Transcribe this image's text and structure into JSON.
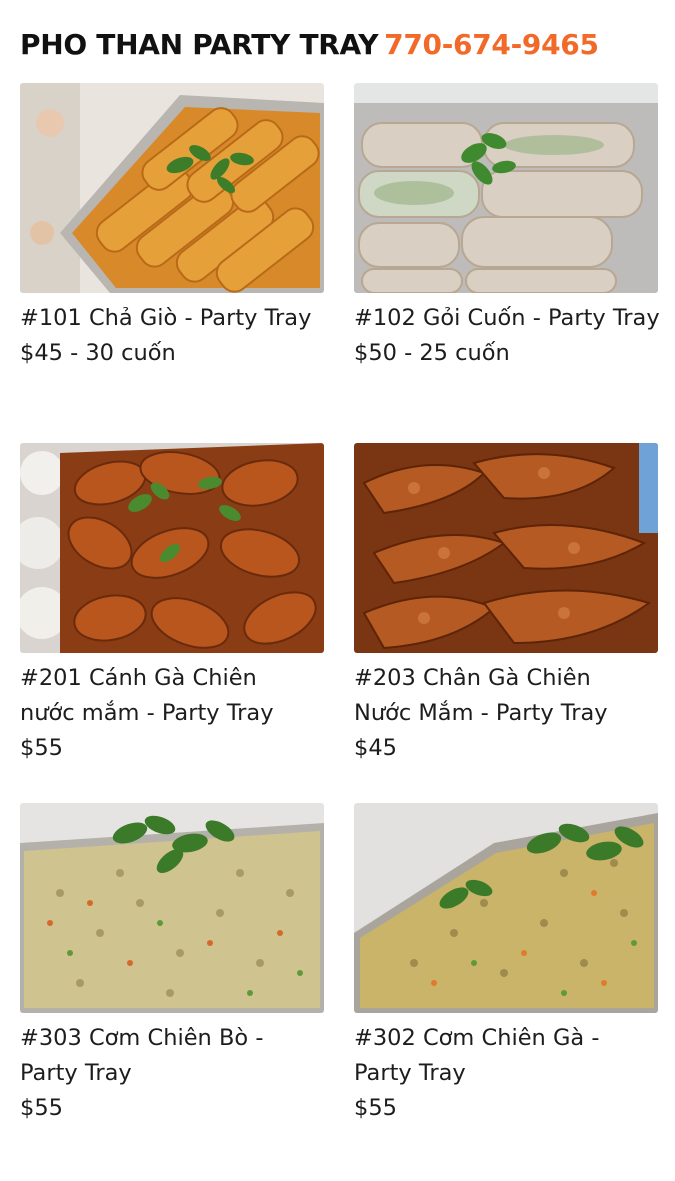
{
  "header": {
    "title": "PHO THAN PARTY TRAY",
    "phone": "770-674-9465"
  },
  "colors": {
    "accent": "#f26a2a"
  },
  "items": [
    {
      "name_lines": [
        "#101 Chả Giò - Party Tray"
      ],
      "price": "$45 - 30 cuốn",
      "photo": "egg-rolls-tray-photo"
    },
    {
      "name_lines": [
        "#102 Gỏi Cuốn - Party Tray"
      ],
      "price": "$50 - 25 cuốn",
      "photo": "spring-rolls-tray-photo"
    },
    {
      "name_lines": [
        "#201 Cánh Gà Chiên",
        "nước mắm - Party Tray"
      ],
      "price": "$55",
      "photo": "fried-chicken-wings-tray-photo"
    },
    {
      "name_lines": [
        "#203 Chân Gà Chiên",
        "Nước Mắm - Party Tray"
      ],
      "price": "$45",
      "photo": "fried-chicken-feet-tray-photo"
    },
    {
      "name_lines": [
        "#303 Cơm Chiên Bò -",
        "Party Tray"
      ],
      "price": "$55",
      "photo": "beef-fried-rice-tray-photo"
    },
    {
      "name_lines": [
        "#302 Cơm Chiên Gà -",
        "Party Tray"
      ],
      "price": "$55",
      "photo": "chicken-fried-rice-tray-photo"
    }
  ]
}
